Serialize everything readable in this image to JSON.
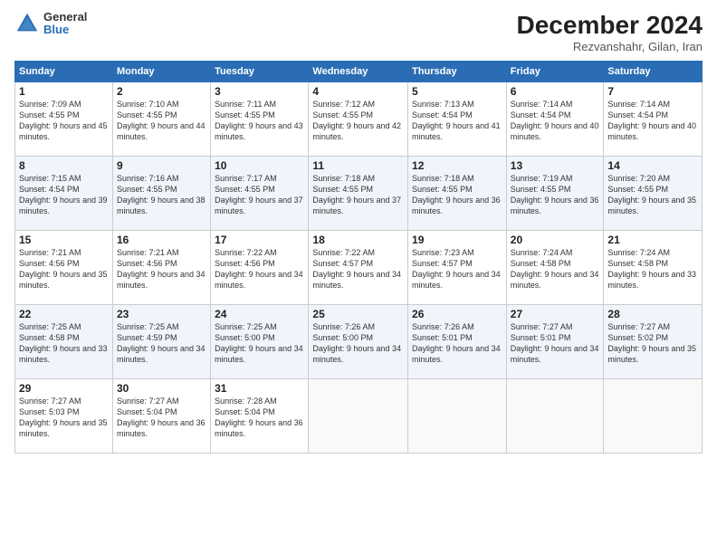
{
  "logo": {
    "general": "General",
    "blue": "Blue"
  },
  "header": {
    "month": "December 2024",
    "location": "Rezvanshahr, Gilan, Iran"
  },
  "weekdays": [
    "Sunday",
    "Monday",
    "Tuesday",
    "Wednesday",
    "Thursday",
    "Friday",
    "Saturday"
  ],
  "weeks": [
    [
      {
        "day": "1",
        "sunrise": "7:09 AM",
        "sunset": "4:55 PM",
        "daylight": "9 hours and 45 minutes."
      },
      {
        "day": "2",
        "sunrise": "7:10 AM",
        "sunset": "4:55 PM",
        "daylight": "9 hours and 44 minutes."
      },
      {
        "day": "3",
        "sunrise": "7:11 AM",
        "sunset": "4:55 PM",
        "daylight": "9 hours and 43 minutes."
      },
      {
        "day": "4",
        "sunrise": "7:12 AM",
        "sunset": "4:55 PM",
        "daylight": "9 hours and 42 minutes."
      },
      {
        "day": "5",
        "sunrise": "7:13 AM",
        "sunset": "4:54 PM",
        "daylight": "9 hours and 41 minutes."
      },
      {
        "day": "6",
        "sunrise": "7:14 AM",
        "sunset": "4:54 PM",
        "daylight": "9 hours and 40 minutes."
      },
      {
        "day": "7",
        "sunrise": "7:14 AM",
        "sunset": "4:54 PM",
        "daylight": "9 hours and 40 minutes."
      }
    ],
    [
      {
        "day": "8",
        "sunrise": "7:15 AM",
        "sunset": "4:54 PM",
        "daylight": "9 hours and 39 minutes."
      },
      {
        "day": "9",
        "sunrise": "7:16 AM",
        "sunset": "4:55 PM",
        "daylight": "9 hours and 38 minutes."
      },
      {
        "day": "10",
        "sunrise": "7:17 AM",
        "sunset": "4:55 PM",
        "daylight": "9 hours and 37 minutes."
      },
      {
        "day": "11",
        "sunrise": "7:18 AM",
        "sunset": "4:55 PM",
        "daylight": "9 hours and 37 minutes."
      },
      {
        "day": "12",
        "sunrise": "7:18 AM",
        "sunset": "4:55 PM",
        "daylight": "9 hours and 36 minutes."
      },
      {
        "day": "13",
        "sunrise": "7:19 AM",
        "sunset": "4:55 PM",
        "daylight": "9 hours and 36 minutes."
      },
      {
        "day": "14",
        "sunrise": "7:20 AM",
        "sunset": "4:55 PM",
        "daylight": "9 hours and 35 minutes."
      }
    ],
    [
      {
        "day": "15",
        "sunrise": "7:21 AM",
        "sunset": "4:56 PM",
        "daylight": "9 hours and 35 minutes."
      },
      {
        "day": "16",
        "sunrise": "7:21 AM",
        "sunset": "4:56 PM",
        "daylight": "9 hours and 34 minutes."
      },
      {
        "day": "17",
        "sunrise": "7:22 AM",
        "sunset": "4:56 PM",
        "daylight": "9 hours and 34 minutes."
      },
      {
        "day": "18",
        "sunrise": "7:22 AM",
        "sunset": "4:57 PM",
        "daylight": "9 hours and 34 minutes."
      },
      {
        "day": "19",
        "sunrise": "7:23 AM",
        "sunset": "4:57 PM",
        "daylight": "9 hours and 34 minutes."
      },
      {
        "day": "20",
        "sunrise": "7:24 AM",
        "sunset": "4:58 PM",
        "daylight": "9 hours and 34 minutes."
      },
      {
        "day": "21",
        "sunrise": "7:24 AM",
        "sunset": "4:58 PM",
        "daylight": "9 hours and 33 minutes."
      }
    ],
    [
      {
        "day": "22",
        "sunrise": "7:25 AM",
        "sunset": "4:58 PM",
        "daylight": "9 hours and 33 minutes."
      },
      {
        "day": "23",
        "sunrise": "7:25 AM",
        "sunset": "4:59 PM",
        "daylight": "9 hours and 34 minutes."
      },
      {
        "day": "24",
        "sunrise": "7:25 AM",
        "sunset": "5:00 PM",
        "daylight": "9 hours and 34 minutes."
      },
      {
        "day": "25",
        "sunrise": "7:26 AM",
        "sunset": "5:00 PM",
        "daylight": "9 hours and 34 minutes."
      },
      {
        "day": "26",
        "sunrise": "7:26 AM",
        "sunset": "5:01 PM",
        "daylight": "9 hours and 34 minutes."
      },
      {
        "day": "27",
        "sunrise": "7:27 AM",
        "sunset": "5:01 PM",
        "daylight": "9 hours and 34 minutes."
      },
      {
        "day": "28",
        "sunrise": "7:27 AM",
        "sunset": "5:02 PM",
        "daylight": "9 hours and 35 minutes."
      }
    ],
    [
      {
        "day": "29",
        "sunrise": "7:27 AM",
        "sunset": "5:03 PM",
        "daylight": "9 hours and 35 minutes."
      },
      {
        "day": "30",
        "sunrise": "7:27 AM",
        "sunset": "5:04 PM",
        "daylight": "9 hours and 36 minutes."
      },
      {
        "day": "31",
        "sunrise": "7:28 AM",
        "sunset": "5:04 PM",
        "daylight": "9 hours and 36 minutes."
      },
      null,
      null,
      null,
      null
    ]
  ]
}
